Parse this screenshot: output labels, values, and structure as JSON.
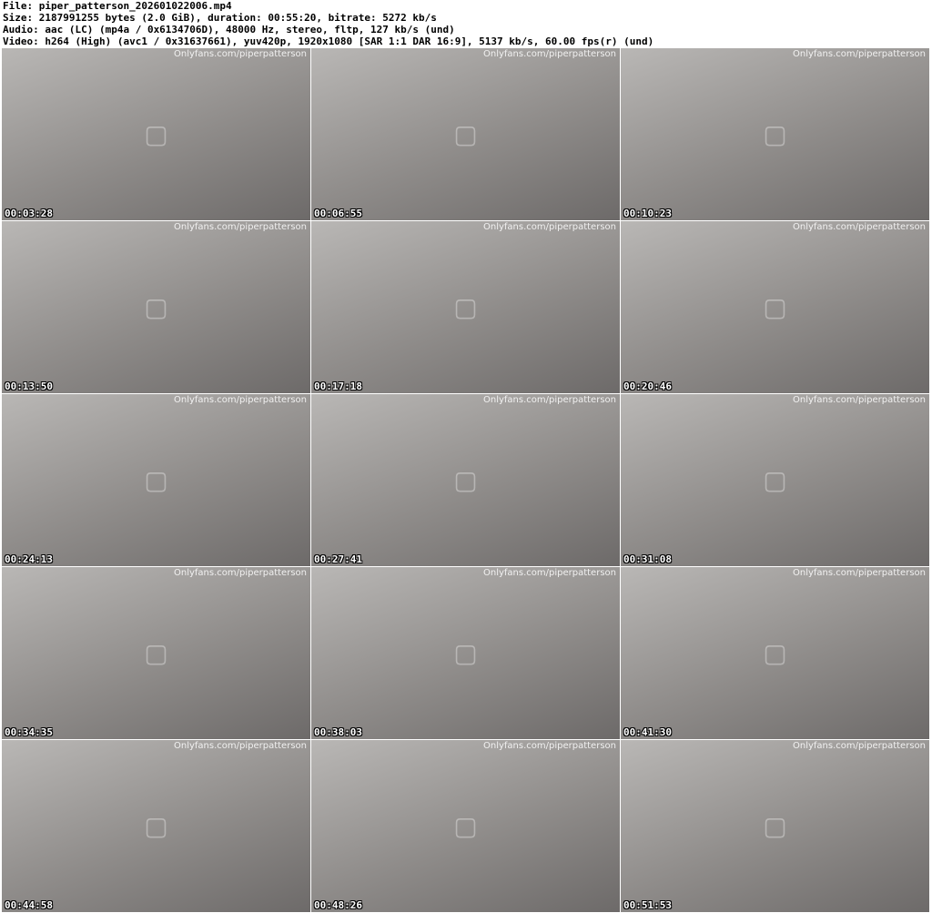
{
  "header": {
    "file": "File: piper_patterson_202601022006.mp4",
    "size": "Size: 2187991255 bytes (2.0 GiB), duration: 00:55:20, bitrate: 5272 kb/s",
    "audio": "Audio: aac (LC) (mp4a / 0x6134706D), 48000 Hz, stereo, fltp, 127 kb/s (und)",
    "video": "Video: h264 (High) (avc1 / 0x31637661), yuv420p, 1920x1080 [SAR 1:1 DAR 16:9], 5137 kb/s, 60.00 fps(r) (und)"
  },
  "watermark": "Onlyfans.com/piperpatterson",
  "thumbnails": [
    {
      "timestamp": "00:03:28"
    },
    {
      "timestamp": "00:06:55"
    },
    {
      "timestamp": "00:10:23"
    },
    {
      "timestamp": "00:13:50"
    },
    {
      "timestamp": "00:17:18"
    },
    {
      "timestamp": "00:20:46"
    },
    {
      "timestamp": "00:24:13"
    },
    {
      "timestamp": "00:27:41"
    },
    {
      "timestamp": "00:31:08"
    },
    {
      "timestamp": "00:34:35"
    },
    {
      "timestamp": "00:38:03"
    },
    {
      "timestamp": "00:41:30"
    },
    {
      "timestamp": "00:44:58"
    },
    {
      "timestamp": "00:48:26"
    },
    {
      "timestamp": "00:51:53"
    }
  ]
}
